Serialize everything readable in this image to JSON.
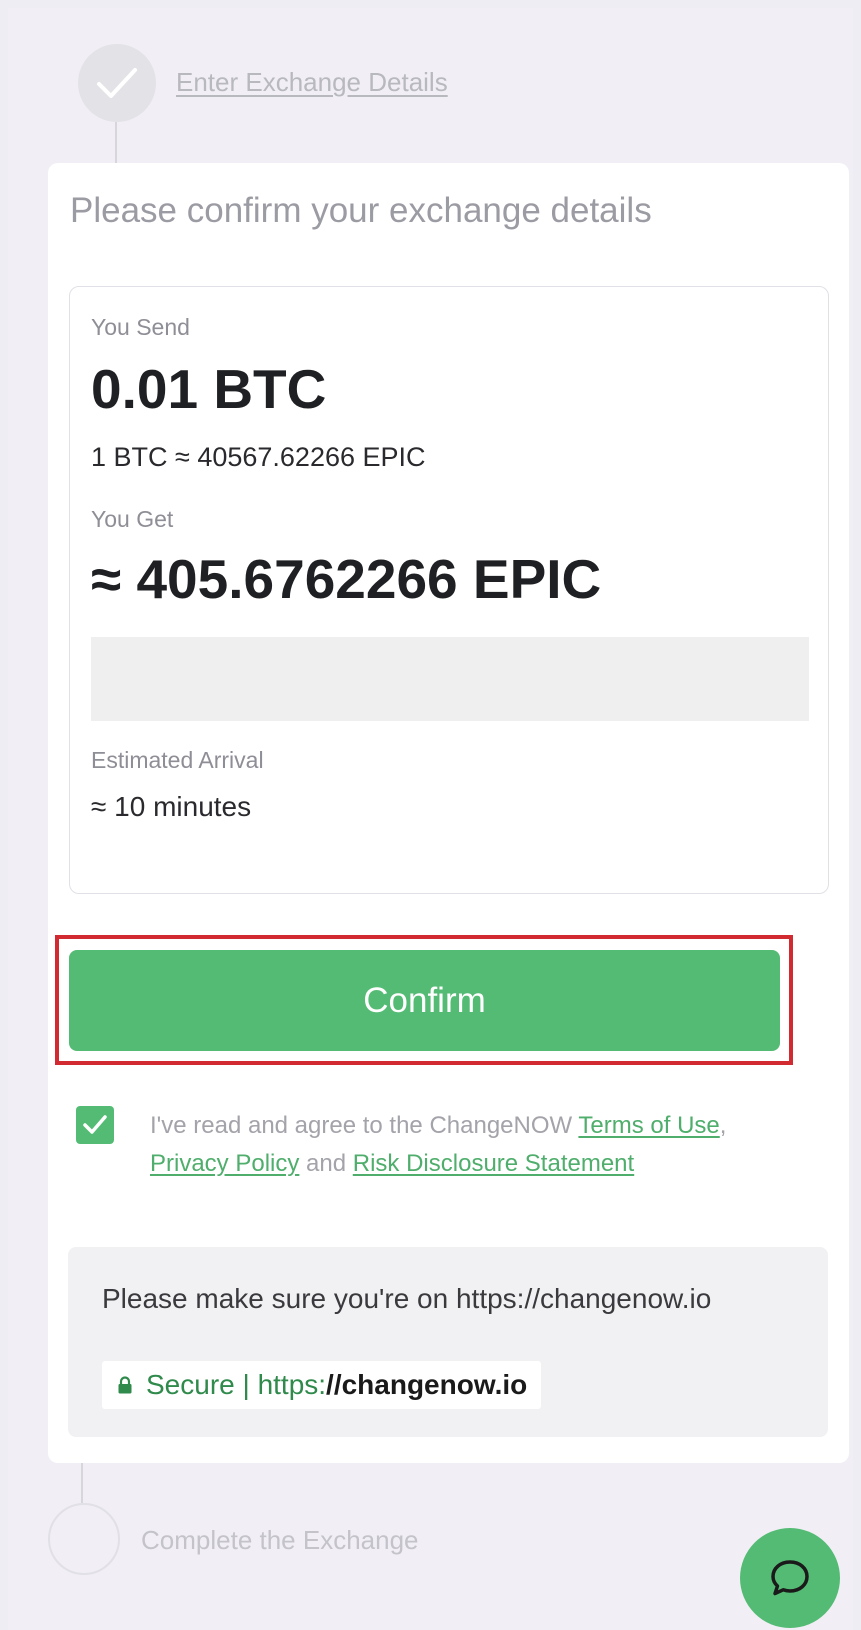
{
  "steps": {
    "step1": {
      "label": "Enter Exchange Details"
    },
    "step2": {
      "label": "Complete the Exchange"
    }
  },
  "card": {
    "title": "Please confirm your exchange details",
    "send": {
      "label": "You Send",
      "amount": "0.01 BTC",
      "rate": "1 BTC ≈ 40567.62266 EPIC"
    },
    "get": {
      "label": "You Get",
      "amount": "≈ 405.6762266 EPIC"
    },
    "arrival": {
      "label": "Estimated Arrival",
      "value": "≈ 10 minutes"
    },
    "confirm_label": "Confirm",
    "agreement": {
      "checked": true,
      "prefix": "I've read and agree to the ChangeNOW ",
      "terms": "Terms of Use",
      "comma": ",",
      "privacy": "Privacy Policy",
      "and": " and ",
      "risk": "Risk Disclosure Statement"
    },
    "notice": {
      "text": "Please make sure you're on https://changenow.io",
      "secure_word": "Secure",
      "separator": " | ",
      "scheme": "https:",
      "domain": "//changenow.io"
    }
  },
  "colors": {
    "accent": "#54bb74",
    "highlight_border": "#d12a30"
  },
  "icons": {
    "step1": "check-icon",
    "lock": "lock-icon",
    "chat": "chat-bubble-icon",
    "checkbox": "checkmark-icon"
  }
}
